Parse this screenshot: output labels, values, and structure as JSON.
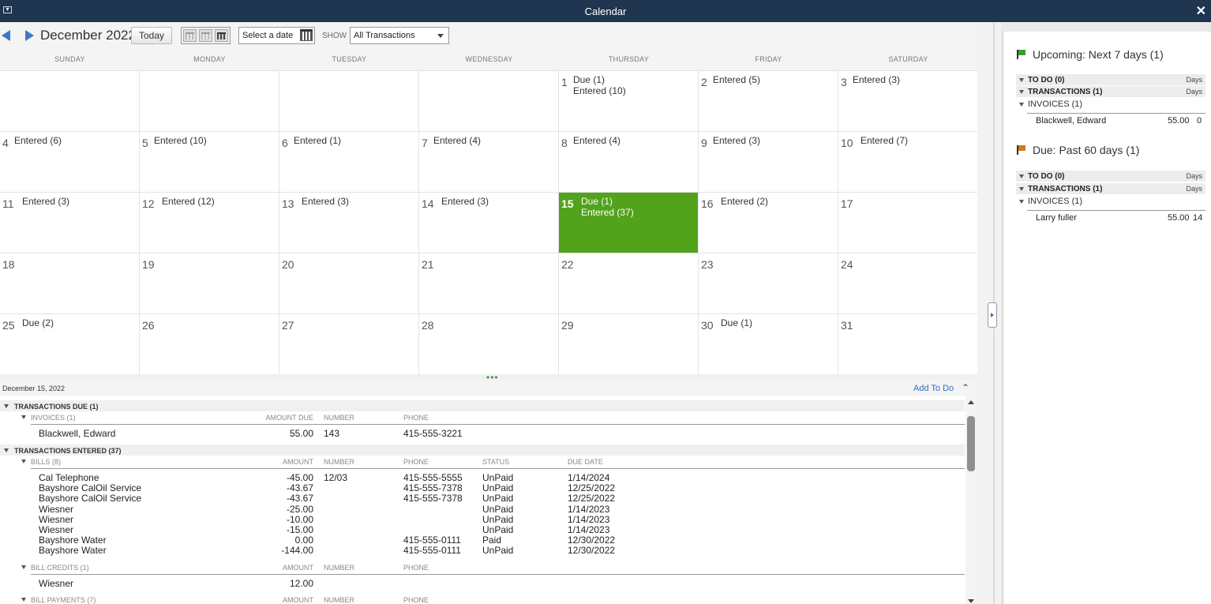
{
  "window": {
    "title": "Calendar"
  },
  "toolbar": {
    "month": "December 2022",
    "today_label": "Today",
    "date_placeholder": "Select a date",
    "show_label": "SHOW",
    "show_value": "All Transactions"
  },
  "days": [
    "SUNDAY",
    "MONDAY",
    "TUESDAY",
    "WEDNESDAY",
    "THURSDAY",
    "FRIDAY",
    "SATURDAY"
  ],
  "calendar": {
    "weeks": [
      [
        {
          "d": ""
        },
        {
          "d": ""
        },
        {
          "d": ""
        },
        {
          "d": ""
        },
        {
          "d": "1",
          "lines": [
            "Due (1)",
            "Entered (10)"
          ]
        },
        {
          "d": "2",
          "lines": [
            "Entered (5)"
          ]
        },
        {
          "d": "3",
          "lines": [
            "Entered (3)"
          ]
        }
      ],
      [
        {
          "d": "4",
          "lines": [
            "Entered (6)"
          ]
        },
        {
          "d": "5",
          "lines": [
            "Entered (10)"
          ]
        },
        {
          "d": "6",
          "lines": [
            "Entered (1)"
          ]
        },
        {
          "d": "7",
          "lines": [
            "Entered (4)"
          ]
        },
        {
          "d": "8",
          "lines": [
            "Entered (4)"
          ]
        },
        {
          "d": "9",
          "lines": [
            "Entered (3)"
          ]
        },
        {
          "d": "10",
          "lines": [
            "Entered (7)"
          ]
        }
      ],
      [
        {
          "d": "11",
          "lines": [
            "Entered (3)"
          ]
        },
        {
          "d": "12",
          "lines": [
            "Entered (12)"
          ]
        },
        {
          "d": "13",
          "lines": [
            "Entered (3)"
          ]
        },
        {
          "d": "14",
          "lines": [
            "Entered (3)"
          ]
        },
        {
          "d": "15",
          "lines": [
            "Due (1)",
            "Entered (37)"
          ],
          "today": true
        },
        {
          "d": "16",
          "lines": [
            "Entered (2)"
          ]
        },
        {
          "d": "17"
        }
      ],
      [
        {
          "d": "18"
        },
        {
          "d": "19"
        },
        {
          "d": "20"
        },
        {
          "d": "21"
        },
        {
          "d": "22"
        },
        {
          "d": "23"
        },
        {
          "d": "24"
        }
      ],
      [
        {
          "d": "25",
          "lines": [
            "Due (2)"
          ]
        },
        {
          "d": "26"
        },
        {
          "d": "27"
        },
        {
          "d": "28"
        },
        {
          "d": "29"
        },
        {
          "d": "30",
          "lines": [
            "Due (1)"
          ]
        },
        {
          "d": "31"
        }
      ]
    ]
  },
  "splitter": {
    "dots": "•••"
  },
  "details": {
    "date": "December 15, 2022",
    "add_todo": "Add To Do",
    "due_section": "TRANSACTIONS DUE (1)",
    "invoices_label": "INVOICES (1)",
    "invoices_cols": [
      "AMOUNT DUE",
      "NUMBER",
      "PHONE"
    ],
    "invoices_rows": [
      [
        "Blackwell, Edward",
        "55.00",
        "143",
        "415-555-3221"
      ]
    ],
    "entered_section": "TRANSACTIONS ENTERED (37)",
    "bills_label": "BILLS (8)",
    "bills_cols": [
      "AMOUNT",
      "NUMBER",
      "PHONE",
      "STATUS",
      "DUE DATE"
    ],
    "bills_rows": [
      [
        "Cal Telephone",
        "-45.00",
        "12/03",
        "415-555-5555",
        "UnPaid",
        "1/14/2024"
      ],
      [
        "Bayshore CalOil Service",
        "-43.67",
        "",
        "415-555-7378",
        "UnPaid",
        "12/25/2022"
      ],
      [
        "Bayshore CalOil Service",
        "-43.67",
        "",
        "415-555-7378",
        "UnPaid",
        "12/25/2022"
      ],
      [
        "Wiesner",
        "-25.00",
        "",
        "",
        "UnPaid",
        "1/14/2023"
      ],
      [
        "Wiesner",
        "-10.00",
        "",
        "",
        "UnPaid",
        "1/14/2023"
      ],
      [
        "Wiesner",
        "-15.00",
        "",
        "",
        "UnPaid",
        "1/14/2023"
      ],
      [
        "Bayshore Water",
        "0.00",
        "",
        "415-555-0111",
        "Paid",
        "12/30/2022"
      ],
      [
        "Bayshore Water",
        "-144.00",
        "",
        "415-555-0111",
        "UnPaid",
        "12/30/2022"
      ]
    ],
    "credits_label": "BILL CREDITS (1)",
    "credits_cols": [
      "AMOUNT",
      "NUMBER",
      "PHONE"
    ],
    "credits_rows": [
      [
        "Wiesner",
        "12.00"
      ]
    ],
    "payments_label": "BILL PAYMENTS (7)",
    "payments_cols": [
      "AMOUNT",
      "NUMBER",
      "PHONE"
    ]
  },
  "sidebar": {
    "upcoming": {
      "title": "Upcoming: Next 7 days (1)",
      "todo": "TO DO (0)",
      "transactions": "TRANSACTIONS (1)",
      "days": "Days",
      "invoices": "INVOICES (1)",
      "row": {
        "name": "Blackwell, Edward",
        "amount": "55.00",
        "days": "0"
      }
    },
    "due": {
      "title": "Due: Past 60 days (1)",
      "todo": "TO DO (0)",
      "transactions": "TRANSACTIONS (1)",
      "days": "Days",
      "invoices": "INVOICES (1)",
      "row": {
        "name": "Larry fuller",
        "amount": "55.00",
        "days": "14"
      }
    }
  },
  "colors": {
    "titlebar": "#1f3550",
    "today": "#52a21c",
    "accent": "#3b79c6",
    "flag_green": "#3e9a36",
    "flag_orange": "#d27a1c"
  }
}
